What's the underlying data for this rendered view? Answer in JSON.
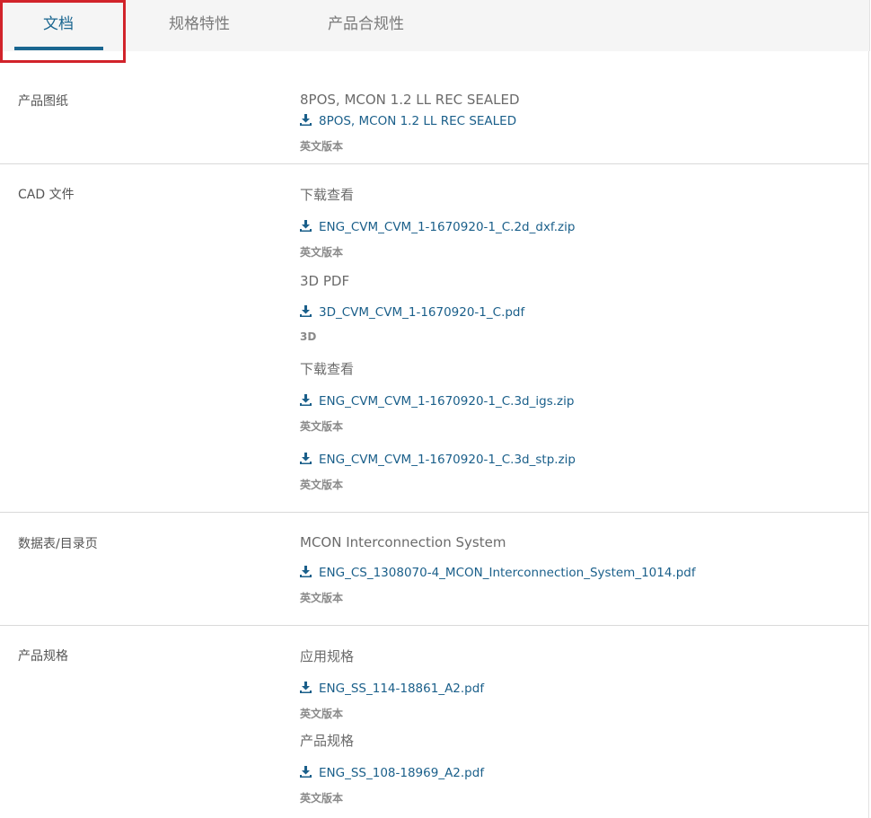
{
  "tabs": [
    {
      "label": "文档"
    },
    {
      "label": "规格特性"
    },
    {
      "label": "产品合规性"
    }
  ],
  "sections": {
    "drawing": {
      "label": "产品图纸",
      "heading": "8POS, MCON 1.2 LL REC SEALED",
      "link": "8POS, MCON 1.2 LL REC SEALED",
      "version": "英文版本"
    },
    "cad": {
      "label": "CAD 文件",
      "groups": [
        {
          "heading": "下载查看",
          "link": "ENG_CVM_CVM_1-1670920-1_C.2d_dxf.zip",
          "version": "英文版本"
        },
        {
          "heading": "3D PDF",
          "link": "3D_CVM_CVM_1-1670920-1_C.pdf",
          "version": "3D"
        },
        {
          "heading": "下载查看",
          "link": "ENG_CVM_CVM_1-1670920-1_C.3d_igs.zip",
          "version": "英文版本"
        },
        {
          "heading": "",
          "link": "ENG_CVM_CVM_1-1670920-1_C.3d_stp.zip",
          "version": "英文版本"
        }
      ]
    },
    "datasheet": {
      "label": "数据表/目录页",
      "heading": "MCON Interconnection System",
      "link": "ENG_CS_1308070-4_MCON_Interconnection_System_1014.pdf",
      "version": "英文版本"
    },
    "spec": {
      "label": "产品规格",
      "groups": [
        {
          "heading": "应用规格",
          "link": "ENG_SS_114-18861_A2.pdf",
          "version": "英文版本"
        },
        {
          "heading": "产品规格",
          "link": "ENG_SS_108-18969_A2.pdf",
          "version": "英文版本"
        }
      ]
    }
  },
  "icons": {
    "download": "download-icon"
  },
  "colors": {
    "accent": "#1a6690",
    "link": "#1a5f8a",
    "highlight": "#d1232a"
  }
}
